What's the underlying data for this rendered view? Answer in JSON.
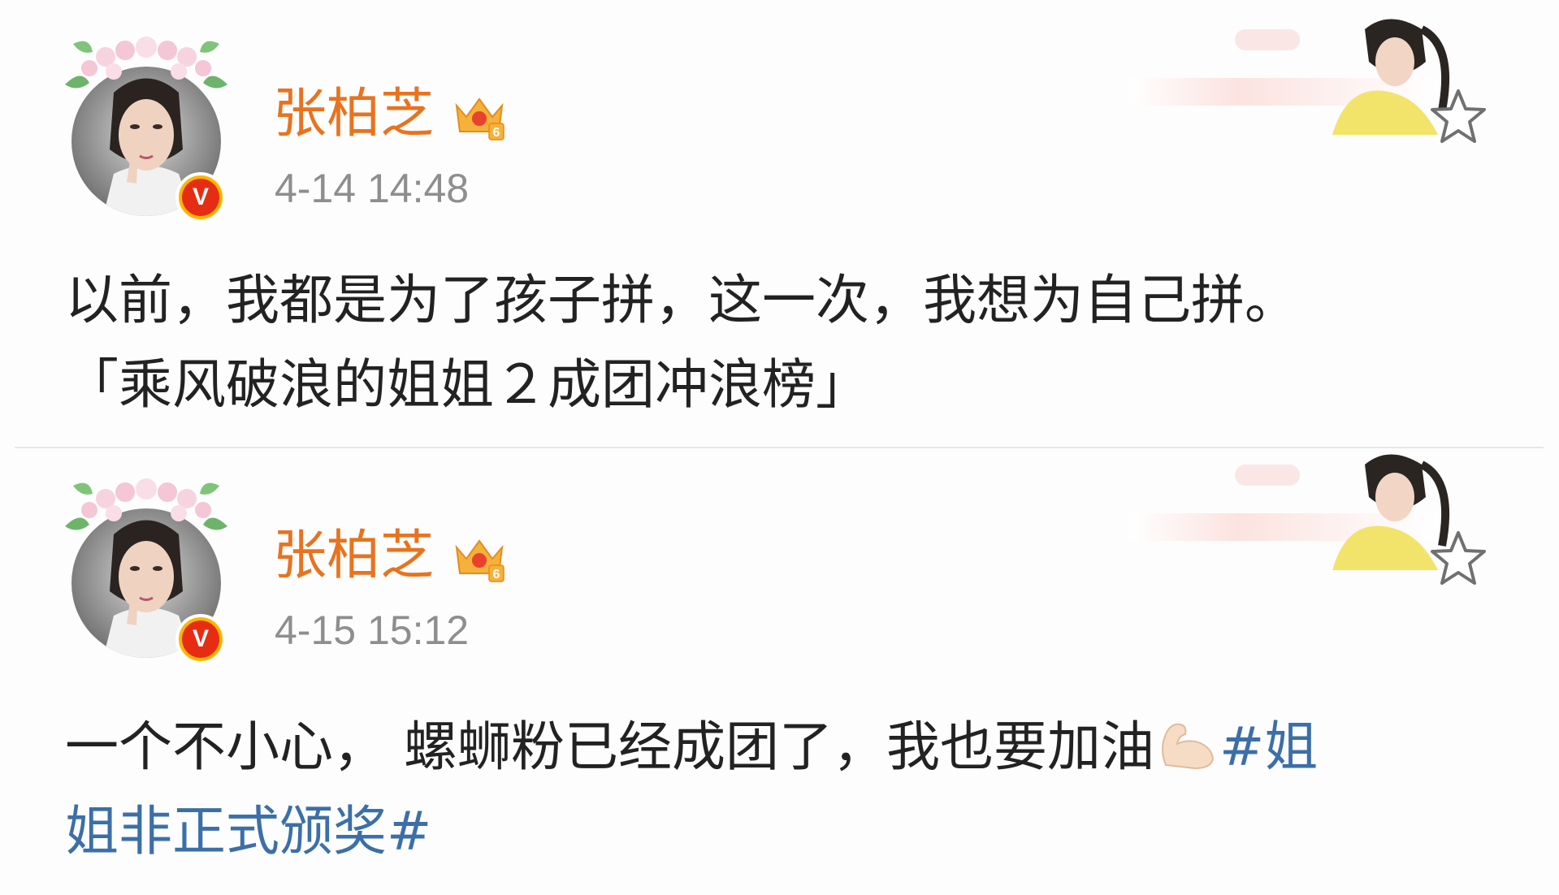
{
  "posts": [
    {
      "username": "张柏芝",
      "timestamp": "4-14 14:48",
      "content_line1": "以前，我都是为了孩子拼，这一次，我想为自己拼。",
      "content_line2": "「乘风破浪的姐姐２成团冲浪榜」",
      "member_level": "6",
      "verified_label": "V"
    },
    {
      "username": "张柏芝",
      "timestamp": "4-15 15:12",
      "content_line1": "一个不小心， 螺蛳粉已经成团了，我也要加油",
      "hashtag_part1": "#姐",
      "hashtag_part2": "姐非正式颁奖#",
      "member_level": "6",
      "verified_label": "V"
    }
  ],
  "colors": {
    "username": "#e8731f",
    "timestamp": "#8e8e8e",
    "text": "#222222",
    "hashtag": "#3c6fa8",
    "verified_red": "#e62d14",
    "verified_ring": "#ffb400"
  },
  "icons": {
    "avatar": "avatar-photo-with-flower-crown",
    "verified": "verified-badge-icon",
    "crown": "vip-crown-icon",
    "star": "star-outline-icon",
    "muscle": "flexed-biceps-emoji",
    "banner": "profile-card-banner"
  }
}
